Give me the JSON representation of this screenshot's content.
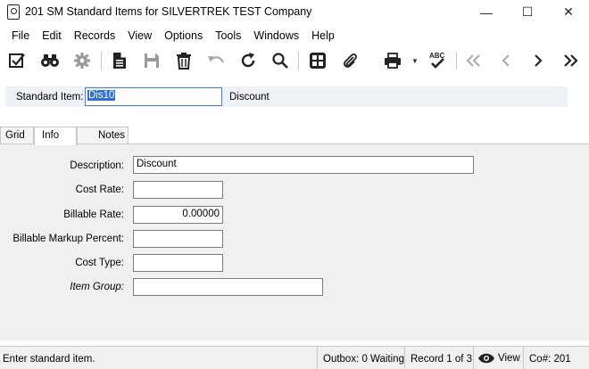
{
  "window": {
    "title": "201 SM Standard Items for SILVERTREK TEST Company",
    "minimize": "—",
    "maximize": "☐",
    "close": "✕"
  },
  "menu": {
    "items": [
      "File",
      "Edit",
      "Records",
      "View",
      "Options",
      "Tools",
      "Windows",
      "Help"
    ]
  },
  "toolbar": {
    "buttons": [
      "edit-check-icon",
      "binoculars-icon",
      "gear-icon",
      "document-icon",
      "save-icon",
      "trash-icon",
      "undo-icon",
      "refresh-icon",
      "search-icon",
      "calculator-icon",
      "paperclip-icon",
      "print-icon",
      "spellcheck-icon",
      "first-record-icon",
      "previous-record-icon",
      "next-record-icon",
      "last-record-icon"
    ],
    "spellcheck_text": "ABC"
  },
  "header": {
    "label": "Standard Item:",
    "value": "Dis10",
    "description": "Discount"
  },
  "tabs": [
    {
      "label": "Grid",
      "active": false
    },
    {
      "label": "Info",
      "active": true
    },
    {
      "label": "Notes",
      "active": false
    }
  ],
  "form": {
    "description": {
      "label": "Description:",
      "value": "Discount"
    },
    "cost_rate": {
      "label": "Cost Rate:",
      "value": ""
    },
    "billable_rate": {
      "label": "Billable Rate:",
      "value": "0.00000"
    },
    "billable_markup": {
      "label": "Billable Markup Percent:",
      "value": ""
    },
    "cost_type": {
      "label": "Cost Type:",
      "value": ""
    },
    "item_group": {
      "label": "Item Group:",
      "value": ""
    }
  },
  "status": {
    "message": "Enter standard item.",
    "outbox": "Outbox: 0 Waiting",
    "record": "Record 1 of 3",
    "view": "View",
    "company": "Co#: 201"
  }
}
